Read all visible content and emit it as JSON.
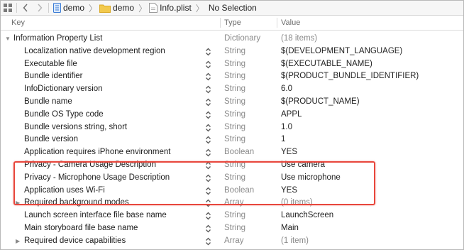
{
  "jumpbar": {
    "crumbs": [
      {
        "label": "demo",
        "icon": "project-icon"
      },
      {
        "label": "demo",
        "icon": "folder-icon"
      },
      {
        "label": "Info.plist",
        "icon": "file-icon"
      },
      {
        "label": "No Selection",
        "icon": ""
      }
    ]
  },
  "columns": {
    "key": "Key",
    "type": "Type",
    "value": "Value"
  },
  "rows": [
    {
      "key": "Information Property List",
      "type": "Dictionary",
      "value": "(18 items)",
      "level": 0,
      "disclosure": "expanded",
      "stepper": false,
      "muted_value": true
    },
    {
      "key": "Localization native development region",
      "type": "String",
      "value": "$(DEVELOPMENT_LANGUAGE)",
      "level": 1,
      "disclosure": "none",
      "stepper": true,
      "muted_value": false
    },
    {
      "key": "Executable file",
      "type": "String",
      "value": "$(EXECUTABLE_NAME)",
      "level": 1,
      "disclosure": "none",
      "stepper": true,
      "muted_value": false
    },
    {
      "key": "Bundle identifier",
      "type": "String",
      "value": "$(PRODUCT_BUNDLE_IDENTIFIER)",
      "level": 1,
      "disclosure": "none",
      "stepper": true,
      "muted_value": false
    },
    {
      "key": "InfoDictionary version",
      "type": "String",
      "value": "6.0",
      "level": 1,
      "disclosure": "none",
      "stepper": true,
      "muted_value": false
    },
    {
      "key": "Bundle name",
      "type": "String",
      "value": "$(PRODUCT_NAME)",
      "level": 1,
      "disclosure": "none",
      "stepper": true,
      "muted_value": false
    },
    {
      "key": "Bundle OS Type code",
      "type": "String",
      "value": "APPL",
      "level": 1,
      "disclosure": "none",
      "stepper": true,
      "muted_value": false
    },
    {
      "key": "Bundle versions string, short",
      "type": "String",
      "value": "1.0",
      "level": 1,
      "disclosure": "none",
      "stepper": true,
      "muted_value": false
    },
    {
      "key": "Bundle version",
      "type": "String",
      "value": "1",
      "level": 1,
      "disclosure": "none",
      "stepper": true,
      "muted_value": false
    },
    {
      "key": "Application requires iPhone environment",
      "type": "Boolean",
      "value": "YES",
      "level": 1,
      "disclosure": "none",
      "stepper": true,
      "muted_value": false
    },
    {
      "key": "Privacy - Camera Usage Description",
      "type": "String",
      "value": "Use camera",
      "level": 1,
      "disclosure": "none",
      "stepper": true,
      "muted_value": false
    },
    {
      "key": "Privacy - Microphone Usage Description",
      "type": "String",
      "value": "Use microphone",
      "level": 1,
      "disclosure": "none",
      "stepper": true,
      "muted_value": false
    },
    {
      "key": "Application uses Wi-Fi",
      "type": "Boolean",
      "value": "YES",
      "level": 1,
      "disclosure": "none",
      "stepper": true,
      "muted_value": false
    },
    {
      "key": "Required background modes",
      "type": "Array",
      "value": "(0 items)",
      "level": 1,
      "disclosure": "collapsed",
      "stepper": true,
      "muted_value": true
    },
    {
      "key": "Launch screen interface file base name",
      "type": "String",
      "value": "LaunchScreen",
      "level": 1,
      "disclosure": "none",
      "stepper": true,
      "muted_value": false
    },
    {
      "key": "Main storyboard file base name",
      "type": "String",
      "value": "Main",
      "level": 1,
      "disclosure": "none",
      "stepper": true,
      "muted_value": false
    },
    {
      "key": "Required device capabilities",
      "type": "Array",
      "value": "(1 item)",
      "level": 1,
      "disclosure": "collapsed",
      "stepper": true,
      "muted_value": true
    }
  ],
  "highlight_color": "#e8473d"
}
